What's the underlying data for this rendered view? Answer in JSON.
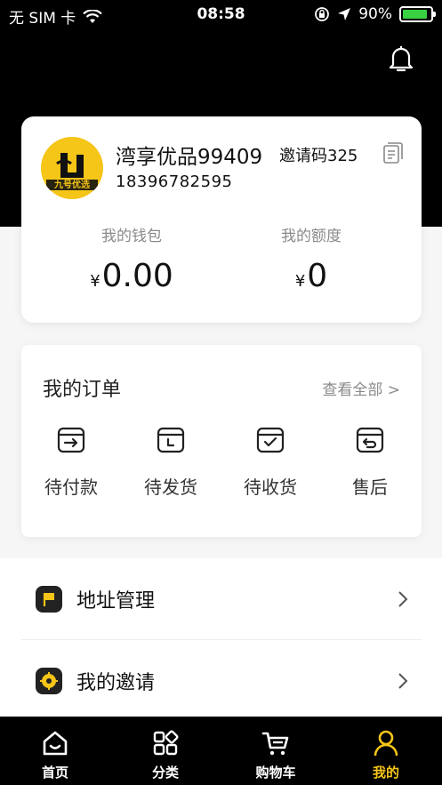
{
  "status_bar": {
    "carrier": "无 SIM 卡",
    "time": "08:58",
    "battery": "90%",
    "battery_level": 0.9
  },
  "profile": {
    "avatar_text": "九号优选",
    "name": "湾享优品99409",
    "invite_code": "邀请码325",
    "phone": "18396782595",
    "wallet_label": "我的钱包",
    "wallet_currency": "¥",
    "wallet_value": "0.00",
    "quota_label": "我的额度",
    "quota_currency": "¥",
    "quota_value": "0"
  },
  "orders": {
    "title": "我的订单",
    "view_all": "查看全部 >",
    "items": [
      {
        "label": "待付款",
        "icon": "pending-payment-icon"
      },
      {
        "label": "待发货",
        "icon": "pending-shipment-icon"
      },
      {
        "label": "待收货",
        "icon": "pending-receipt-icon"
      },
      {
        "label": "售后",
        "icon": "after-sales-icon"
      }
    ]
  },
  "menu": [
    {
      "label": "地址管理",
      "icon": "flag-icon"
    },
    {
      "label": "我的邀请",
      "icon": "invite-icon"
    }
  ],
  "tabs": [
    {
      "label": "首页",
      "icon": "home-icon",
      "active": false
    },
    {
      "label": "分类",
      "icon": "category-icon",
      "active": false
    },
    {
      "label": "购物车",
      "icon": "cart-icon",
      "active": false
    },
    {
      "label": "我的",
      "icon": "profile-icon",
      "active": true
    }
  ],
  "colors": {
    "accent": "#f5c518",
    "header_bg": "#000000",
    "battery": "#38d142"
  }
}
